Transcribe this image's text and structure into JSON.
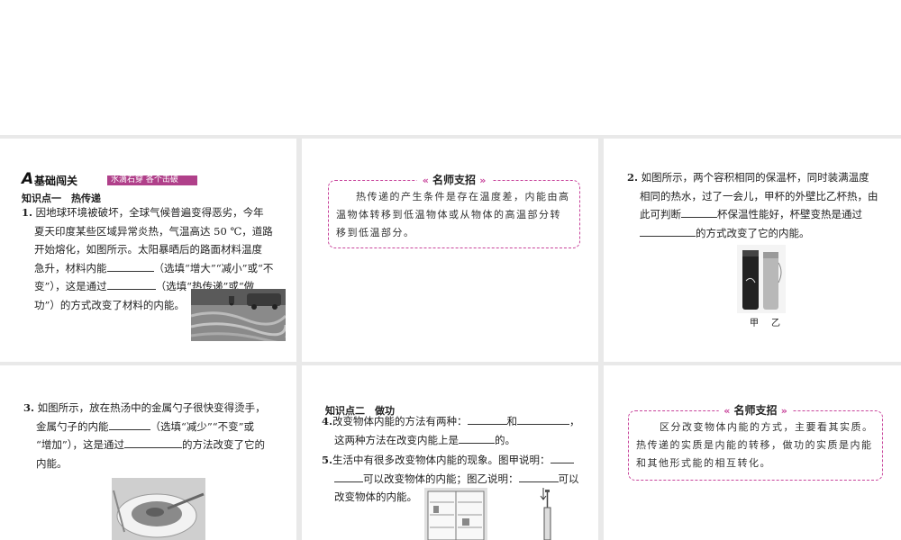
{
  "section": {
    "letter": "A",
    "title": "基础闯关",
    "slogan": "水滴石穿 各个击破"
  },
  "kp1": {
    "title": "知识点一　热传递"
  },
  "q1": {
    "num": "1.",
    "line1": "因地球环境被破坏，全球气候普遍变得恶劣，今年",
    "line2": "夏天印度某些区域异常炎热，气温高达 50 ℃，道路",
    "line3": "开始熔化，如图所示。太阳暴晒后的路面材料温度",
    "line4": "急升，材料内能",
    "line4b": "（选填“增大”“减小”或“不",
    "line5": "变”），这是通过",
    "line5b": "（选填“热传递”或“做",
    "line6": "功”）的方式改变了材料的内能。"
  },
  "tip1": {
    "title": "名师支招",
    "line1": "热传递的产生条件是存在温度差，内能由高",
    "line2": "温物体转移到低温物体或从物体的高温部分转",
    "line3": "移到低温部分。"
  },
  "q2": {
    "num": "2.",
    "line1": "如图所示，两个容积相同的保温杯，同时装满温度",
    "line2": "相同的热水，过了一会儿，甲杯的外壁比乙杯热，由",
    "line3a": "此可判断",
    "line3b": "杯保温性能好，杯壁变热是通过",
    "line4b": "的方式改变了它的内能。",
    "caption": "甲乙"
  },
  "q3": {
    "num": "3.",
    "line1": "如图所示，放在热汤中的金属勺子很快变得烫手，",
    "line2a": "金属勺子的内能",
    "line2b": "（选填“减少”“不变”或",
    "line3a": "“增加”），这是通过",
    "line3b": "的方法改变了它的",
    "line4": "内能。"
  },
  "kp2": {
    "title": "知识点二　做功"
  },
  "q4": {
    "num": "4.",
    "line1a": "改变物体内能的方法有两种：",
    "line1b": "和",
    "line1c": "，",
    "line2a": "这两种方法在改变内能上是",
    "line2b": "的。"
  },
  "q5": {
    "num": "5.",
    "line1a": "生活中有很多改变物体内能的现象。图甲说明：",
    "line2a": "可以改变物体的内能；图乙说明：",
    "line2b": "可以",
    "line3": "改变物体的内能。"
  },
  "tip2": {
    "title": "名师支招",
    "line1": "区分改变物体内能的方式，主要看其实质。",
    "line2": "热传递的实质是内能的转移，做功的实质是内能",
    "line3": "和其他形式能的相互转化。"
  },
  "colors": {
    "accent": "#c8449b",
    "section_bar": "#b0408a",
    "gutter": "#e9e9e9"
  }
}
